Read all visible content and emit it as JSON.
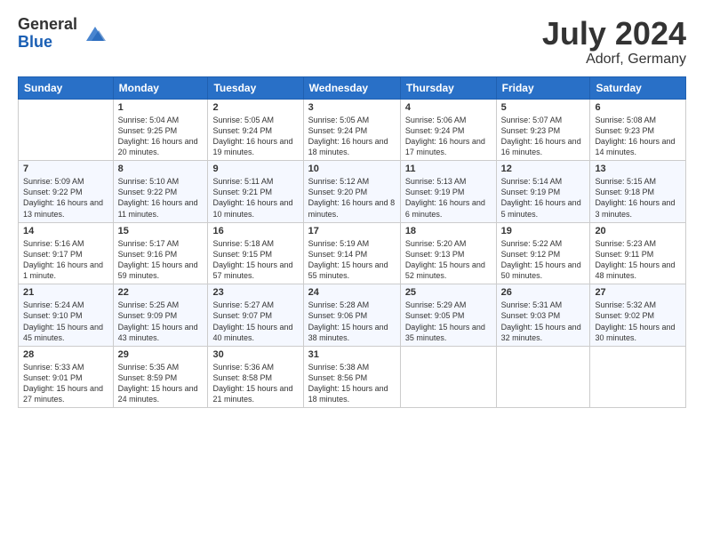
{
  "header": {
    "logo_general": "General",
    "logo_blue": "Blue",
    "month_year": "July 2024",
    "location": "Adorf, Germany"
  },
  "days_of_week": [
    "Sunday",
    "Monday",
    "Tuesday",
    "Wednesday",
    "Thursday",
    "Friday",
    "Saturday"
  ],
  "weeks": [
    [
      {
        "day": "",
        "sunrise": "",
        "sunset": "",
        "daylight": ""
      },
      {
        "day": "1",
        "sunrise": "Sunrise: 5:04 AM",
        "sunset": "Sunset: 9:25 PM",
        "daylight": "Daylight: 16 hours and 20 minutes."
      },
      {
        "day": "2",
        "sunrise": "Sunrise: 5:05 AM",
        "sunset": "Sunset: 9:24 PM",
        "daylight": "Daylight: 16 hours and 19 minutes."
      },
      {
        "day": "3",
        "sunrise": "Sunrise: 5:05 AM",
        "sunset": "Sunset: 9:24 PM",
        "daylight": "Daylight: 16 hours and 18 minutes."
      },
      {
        "day": "4",
        "sunrise": "Sunrise: 5:06 AM",
        "sunset": "Sunset: 9:24 PM",
        "daylight": "Daylight: 16 hours and 17 minutes."
      },
      {
        "day": "5",
        "sunrise": "Sunrise: 5:07 AM",
        "sunset": "Sunset: 9:23 PM",
        "daylight": "Daylight: 16 hours and 16 minutes."
      },
      {
        "day": "6",
        "sunrise": "Sunrise: 5:08 AM",
        "sunset": "Sunset: 9:23 PM",
        "daylight": "Daylight: 16 hours and 14 minutes."
      }
    ],
    [
      {
        "day": "7",
        "sunrise": "Sunrise: 5:09 AM",
        "sunset": "Sunset: 9:22 PM",
        "daylight": "Daylight: 16 hours and 13 minutes."
      },
      {
        "day": "8",
        "sunrise": "Sunrise: 5:10 AM",
        "sunset": "Sunset: 9:22 PM",
        "daylight": "Daylight: 16 hours and 11 minutes."
      },
      {
        "day": "9",
        "sunrise": "Sunrise: 5:11 AM",
        "sunset": "Sunset: 9:21 PM",
        "daylight": "Daylight: 16 hours and 10 minutes."
      },
      {
        "day": "10",
        "sunrise": "Sunrise: 5:12 AM",
        "sunset": "Sunset: 9:20 PM",
        "daylight": "Daylight: 16 hours and 8 minutes."
      },
      {
        "day": "11",
        "sunrise": "Sunrise: 5:13 AM",
        "sunset": "Sunset: 9:19 PM",
        "daylight": "Daylight: 16 hours and 6 minutes."
      },
      {
        "day": "12",
        "sunrise": "Sunrise: 5:14 AM",
        "sunset": "Sunset: 9:19 PM",
        "daylight": "Daylight: 16 hours and 5 minutes."
      },
      {
        "day": "13",
        "sunrise": "Sunrise: 5:15 AM",
        "sunset": "Sunset: 9:18 PM",
        "daylight": "Daylight: 16 hours and 3 minutes."
      }
    ],
    [
      {
        "day": "14",
        "sunrise": "Sunrise: 5:16 AM",
        "sunset": "Sunset: 9:17 PM",
        "daylight": "Daylight: 16 hours and 1 minute."
      },
      {
        "day": "15",
        "sunrise": "Sunrise: 5:17 AM",
        "sunset": "Sunset: 9:16 PM",
        "daylight": "Daylight: 15 hours and 59 minutes."
      },
      {
        "day": "16",
        "sunrise": "Sunrise: 5:18 AM",
        "sunset": "Sunset: 9:15 PM",
        "daylight": "Daylight: 15 hours and 57 minutes."
      },
      {
        "day": "17",
        "sunrise": "Sunrise: 5:19 AM",
        "sunset": "Sunset: 9:14 PM",
        "daylight": "Daylight: 15 hours and 55 minutes."
      },
      {
        "day": "18",
        "sunrise": "Sunrise: 5:20 AM",
        "sunset": "Sunset: 9:13 PM",
        "daylight": "Daylight: 15 hours and 52 minutes."
      },
      {
        "day": "19",
        "sunrise": "Sunrise: 5:22 AM",
        "sunset": "Sunset: 9:12 PM",
        "daylight": "Daylight: 15 hours and 50 minutes."
      },
      {
        "day": "20",
        "sunrise": "Sunrise: 5:23 AM",
        "sunset": "Sunset: 9:11 PM",
        "daylight": "Daylight: 15 hours and 48 minutes."
      }
    ],
    [
      {
        "day": "21",
        "sunrise": "Sunrise: 5:24 AM",
        "sunset": "Sunset: 9:10 PM",
        "daylight": "Daylight: 15 hours and 45 minutes."
      },
      {
        "day": "22",
        "sunrise": "Sunrise: 5:25 AM",
        "sunset": "Sunset: 9:09 PM",
        "daylight": "Daylight: 15 hours and 43 minutes."
      },
      {
        "day": "23",
        "sunrise": "Sunrise: 5:27 AM",
        "sunset": "Sunset: 9:07 PM",
        "daylight": "Daylight: 15 hours and 40 minutes."
      },
      {
        "day": "24",
        "sunrise": "Sunrise: 5:28 AM",
        "sunset": "Sunset: 9:06 PM",
        "daylight": "Daylight: 15 hours and 38 minutes."
      },
      {
        "day": "25",
        "sunrise": "Sunrise: 5:29 AM",
        "sunset": "Sunset: 9:05 PM",
        "daylight": "Daylight: 15 hours and 35 minutes."
      },
      {
        "day": "26",
        "sunrise": "Sunrise: 5:31 AM",
        "sunset": "Sunset: 9:03 PM",
        "daylight": "Daylight: 15 hours and 32 minutes."
      },
      {
        "day": "27",
        "sunrise": "Sunrise: 5:32 AM",
        "sunset": "Sunset: 9:02 PM",
        "daylight": "Daylight: 15 hours and 30 minutes."
      }
    ],
    [
      {
        "day": "28",
        "sunrise": "Sunrise: 5:33 AM",
        "sunset": "Sunset: 9:01 PM",
        "daylight": "Daylight: 15 hours and 27 minutes."
      },
      {
        "day": "29",
        "sunrise": "Sunrise: 5:35 AM",
        "sunset": "Sunset: 8:59 PM",
        "daylight": "Daylight: 15 hours and 24 minutes."
      },
      {
        "day": "30",
        "sunrise": "Sunrise: 5:36 AM",
        "sunset": "Sunset: 8:58 PM",
        "daylight": "Daylight: 15 hours and 21 minutes."
      },
      {
        "day": "31",
        "sunrise": "Sunrise: 5:38 AM",
        "sunset": "Sunset: 8:56 PM",
        "daylight": "Daylight: 15 hours and 18 minutes."
      },
      {
        "day": "",
        "sunrise": "",
        "sunset": "",
        "daylight": ""
      },
      {
        "day": "",
        "sunrise": "",
        "sunset": "",
        "daylight": ""
      },
      {
        "day": "",
        "sunrise": "",
        "sunset": "",
        "daylight": ""
      }
    ]
  ]
}
